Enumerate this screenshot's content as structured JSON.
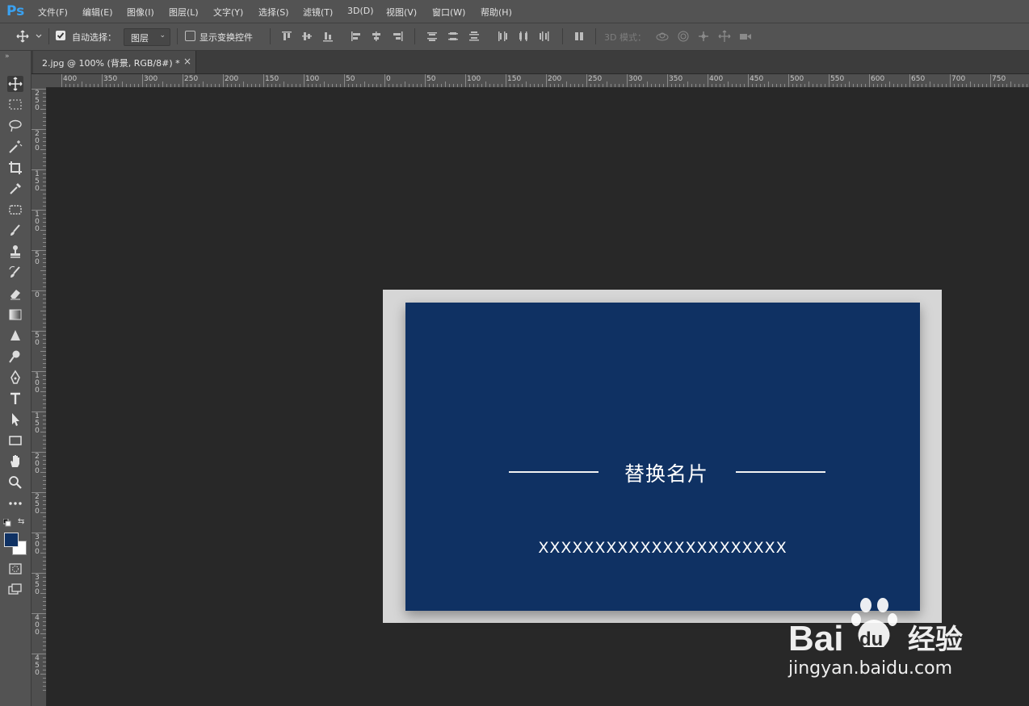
{
  "app": {
    "logo": "Ps",
    "menu": [
      "文件(F)",
      "编辑(E)",
      "图像(I)",
      "图层(L)",
      "文字(Y)",
      "选择(S)",
      "滤镜(T)",
      "3D(D)",
      "视图(V)",
      "窗口(W)",
      "帮助(H)"
    ]
  },
  "options": {
    "auto_select_label": "自动选择：",
    "auto_select_checked": true,
    "layer_select_value": "图层",
    "show_transform_label": "显示变换控件",
    "show_transform_checked": false,
    "mode_3d_label": "3D 模式："
  },
  "document": {
    "tab_title": "2.jpg @ 100% (背景, RGB/8#) *",
    "tab_close": "×"
  },
  "ruler": {
    "top_labels": [
      "400",
      "350",
      "300",
      "250",
      "200",
      "150",
      "100",
      "50",
      "0",
      "50",
      "100",
      "150",
      "200",
      "250",
      "300",
      "350",
      "400",
      "450",
      "500",
      "550",
      "600",
      "650",
      "700",
      "750"
    ],
    "left_labels": [
      "250",
      "200",
      "150",
      "100",
      "50",
      "0",
      "50",
      "100",
      "150",
      "200",
      "250",
      "300",
      "350",
      "400",
      "450"
    ]
  },
  "canvas": {
    "card_title": "替换名片",
    "card_subtitle": "XXXXXXXXXXXXXXXXXXXXXX",
    "card_color": "#0f3163",
    "frame_color": "#d6d6d6"
  },
  "colors": {
    "foreground": "#0f3163",
    "background": "#ffffff"
  },
  "watermark": {
    "logo_text": "Bai",
    "logo_text_2": "du",
    "brand": "经验",
    "url": "jingyan.baidu.com"
  }
}
